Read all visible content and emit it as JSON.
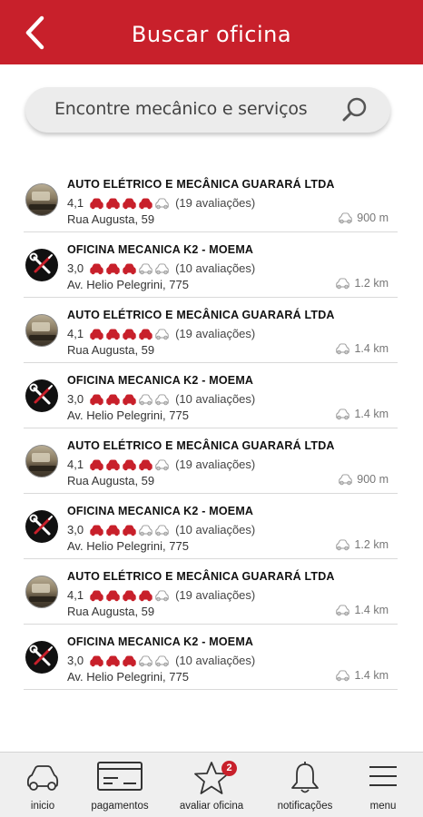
{
  "header": {
    "title": "Buscar oficina",
    "back_icon": "chevron-left-icon",
    "background": "#c8202b"
  },
  "search": {
    "placeholder": "Encontre mecânico e serviços",
    "icon": "search-icon"
  },
  "workshops": [
    {
      "name": "AUTO ELÉTRICO E MECÂNICA GUARARÁ LTDA",
      "rating": "4,1",
      "filled": 4,
      "reviews": "(19 avaliações)",
      "address": "Rua Augusta, 59",
      "distance": "900 m",
      "avatar": "photo"
    },
    {
      "name": "OFICINA MECANICA K2 - MOEMA",
      "rating": "3,0",
      "filled": 3,
      "reviews": "(10 avaliações)",
      "address": "Av. Helio Pelegrini, 775",
      "distance": "1.2 km",
      "avatar": "logo"
    },
    {
      "name": "AUTO ELÉTRICO E MECÂNICA GUARARÁ LTDA",
      "rating": "4,1",
      "filled": 4,
      "reviews": "(19 avaliações)",
      "address": "Rua Augusta, 59",
      "distance": "1.4 km",
      "avatar": "photo"
    },
    {
      "name": "OFICINA MECANICA K2 - MOEMA",
      "rating": "3,0",
      "filled": 3,
      "reviews": "(10 avaliações)",
      "address": "Av. Helio Pelegrini, 775",
      "distance": "1.4 km",
      "avatar": "logo"
    },
    {
      "name": "AUTO ELÉTRICO E MECÂNICA GUARARÁ LTDA",
      "rating": "4,1",
      "filled": 4,
      "reviews": "(19 avaliações)",
      "address": "Rua Augusta, 59",
      "distance": "900 m",
      "avatar": "photo"
    },
    {
      "name": "OFICINA MECANICA K2 - MOEMA",
      "rating": "3,0",
      "filled": 3,
      "reviews": "(10 avaliações)",
      "address": "Av. Helio Pelegrini, 775",
      "distance": "1.2 km",
      "avatar": "logo"
    },
    {
      "name": "AUTO ELÉTRICO E MECÂNICA GUARARÁ LTDA",
      "rating": "4,1",
      "filled": 4,
      "reviews": "(19 avaliações)",
      "address": "Rua Augusta, 59",
      "distance": "1.4 km",
      "avatar": "photo"
    },
    {
      "name": "OFICINA MECANICA K2 - MOEMA",
      "rating": "3,0",
      "filled": 3,
      "reviews": "(10 avaliações)",
      "address": "Av. Helio Pelegrini, 775",
      "distance": "1.4 km",
      "avatar": "logo"
    }
  ],
  "rating_colors": {
    "filled": "#c8202b",
    "empty": "#9a9a9a"
  },
  "nav": {
    "items": [
      {
        "label": "inicio",
        "icon": "car-icon"
      },
      {
        "label": "pagamentos",
        "icon": "card-icon"
      },
      {
        "label": "avaliar oficina",
        "icon": "star-icon",
        "badge": "2"
      },
      {
        "label": "notificações",
        "icon": "bell-icon"
      },
      {
        "label": "menu",
        "icon": "hamburger-icon"
      }
    ]
  }
}
